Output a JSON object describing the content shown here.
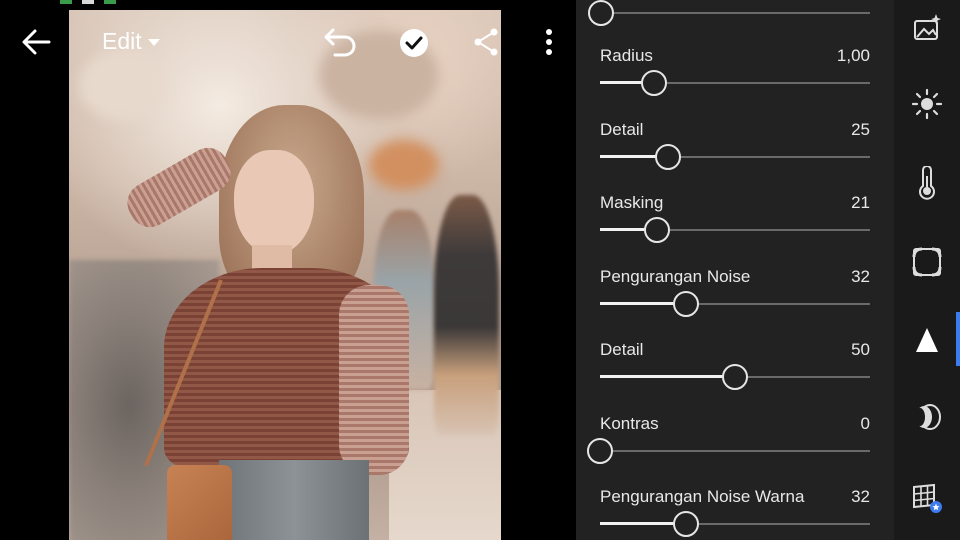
{
  "toolbar": {
    "edit_label": "Edit"
  },
  "detail_panel": {
    "sliders": [
      {
        "label": "Radius",
        "value": "1,00",
        "position": 0.2
      },
      {
        "label": "Detail",
        "value": "25",
        "position": 0.25
      },
      {
        "label": "Masking",
        "value": "21",
        "position": 0.21
      },
      {
        "label": "Pengurangan Noise",
        "value": "32",
        "position": 0.32
      },
      {
        "label": "Detail",
        "value": "50",
        "position": 0.5
      },
      {
        "label": "Kontras",
        "value": "0",
        "position": 0.0
      },
      {
        "label": "Pengurangan Noise Warna",
        "value": "32",
        "position": 0.32
      }
    ]
  },
  "tool_rail": {
    "items": [
      "auto-magic-icon",
      "light-icon",
      "color-thermometer-icon",
      "effects-vignette-icon",
      "detail-triangle-icon",
      "optics-lens-icon",
      "geometry-grid-icon"
    ],
    "active": "detail-triangle-icon"
  },
  "colors": {
    "panel_bg": "#222222",
    "rail_bg": "#1a1a1a",
    "accent": "#3d7cf0"
  }
}
